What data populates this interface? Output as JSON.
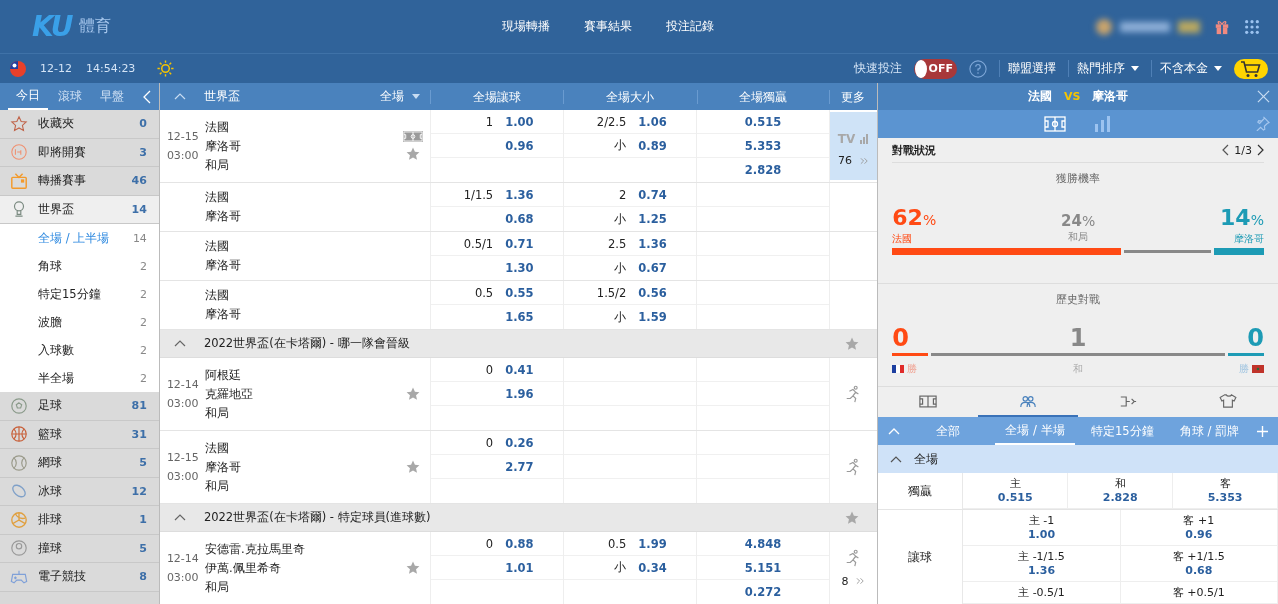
{
  "header": {
    "logo": {
      "mark": "KU",
      "text": "體育"
    },
    "nav": [
      "現場轉播",
      "賽事結果",
      "投注記錄"
    ]
  },
  "subbar": {
    "date": "12-12",
    "time": "14:54:23",
    "quick_bet": {
      "label": "快速投注",
      "on": false,
      "state_text": "OFF"
    },
    "menus": [
      {
        "label": "聯盟選擇",
        "dropdown": false
      },
      {
        "label": "熱門排序",
        "dropdown": true
      },
      {
        "label": "不含本金",
        "dropdown": true
      }
    ]
  },
  "sidebar": {
    "tabs": [
      {
        "label": "今日",
        "selected": true
      },
      {
        "label": "滾球",
        "selected": false
      },
      {
        "label": "早盤",
        "selected": false
      }
    ],
    "items": [
      {
        "kind": "star",
        "label": "收藏夾",
        "count": "0",
        "expanded": false
      },
      {
        "kind": "clock",
        "label": "即將開賽",
        "count": "3",
        "expanded": false
      },
      {
        "kind": "tv",
        "label": "轉播賽事",
        "count": "46",
        "expanded": false
      },
      {
        "kind": "trophy",
        "label": "世界盃",
        "count": "14",
        "expanded": true,
        "children": [
          {
            "label": "全場 / 上半場",
            "count": "14",
            "selected": true
          },
          {
            "label": "角球",
            "count": "2",
            "selected": false
          },
          {
            "label": "特定15分鐘",
            "count": "2",
            "selected": false
          },
          {
            "label": "波膽",
            "count": "2",
            "selected": false
          },
          {
            "label": "入球數",
            "count": "2",
            "selected": false
          },
          {
            "label": "半全場",
            "count": "2",
            "selected": false
          }
        ]
      },
      {
        "kind": "soccer",
        "label": "足球",
        "count": "81",
        "expanded": false
      },
      {
        "kind": "basketball",
        "label": "籃球",
        "count": "31",
        "expanded": false
      },
      {
        "kind": "tennis",
        "label": "網球",
        "count": "5",
        "expanded": false
      },
      {
        "kind": "hockey",
        "label": "冰球",
        "count": "12",
        "expanded": false
      },
      {
        "kind": "volleyball",
        "label": "排球",
        "count": "1",
        "expanded": false
      },
      {
        "kind": "billiards",
        "label": "撞球",
        "count": "5",
        "expanded": false
      },
      {
        "kind": "gamepad",
        "label": "電子競技",
        "count": "8",
        "expanded": false
      }
    ]
  },
  "table": {
    "league": "世界盃",
    "period": "全場",
    "columns": [
      "全場讓球",
      "全場大小",
      "全場獨贏",
      "更多"
    ],
    "groups": [
      {
        "matches": [
          {
            "date": "12-15",
            "time": "03:00",
            "teams": [
              "法國",
              "摩洛哥",
              "和局"
            ],
            "field_icon": true,
            "favorite": false,
            "lines": [
              {
                "hdp": "1",
                "hdp_odds": "1.00",
                "ou": "2/2.5",
                "ou_odds": "1.06",
                "win": "0.515"
              },
              {
                "hdp_odds": "0.96",
                "ou": "小",
                "ou_odds": "0.89",
                "win": "5.353"
              },
              {
                "win": "2.828"
              }
            ],
            "more": {
              "kind": "tv",
              "label": "TV",
              "count": "76",
              "selected": true
            }
          },
          {
            "teams": [
              "法國",
              "摩洛哥"
            ],
            "lines": [
              {
                "hdp": "1/1.5",
                "hdp_odds": "1.36",
                "ou": "2",
                "ou_odds": "0.74"
              },
              {
                "hdp_odds": "0.68",
                "ou": "小",
                "ou_odds": "1.25"
              }
            ]
          },
          {
            "teams": [
              "法國",
              "摩洛哥"
            ],
            "lines": [
              {
                "hdp": "0.5/1",
                "hdp_odds": "0.71",
                "ou": "2.5",
                "ou_odds": "1.36"
              },
              {
                "hdp_odds": "1.30",
                "ou": "小",
                "ou_odds": "0.67"
              }
            ]
          },
          {
            "teams": [
              "法國",
              "摩洛哥"
            ],
            "lines": [
              {
                "hdp": "0.5",
                "hdp_odds": "0.55",
                "ou": "1.5/2",
                "ou_odds": "0.56"
              },
              {
                "hdp_odds": "1.65",
                "ou": "小",
                "ou_odds": "1.59"
              }
            ]
          }
        ]
      },
      {
        "title": "2022世界盃(在卡塔爾) - 哪一隊會晉級",
        "matches": [
          {
            "date": "12-14",
            "time": "03:00",
            "teams": [
              "阿根廷",
              "克羅地亞",
              "和局"
            ],
            "favorite": false,
            "lines": [
              {
                "hdp": "0",
                "hdp_odds": "0.41"
              },
              {
                "hdp_odds": "1.96"
              }
            ],
            "more": {
              "kind": "live",
              "selected": false
            }
          },
          {
            "date": "12-15",
            "time": "03:00",
            "teams": [
              "法國",
              "摩洛哥",
              "和局"
            ],
            "favorite": false,
            "lines": [
              {
                "hdp": "0",
                "hdp_odds": "0.26"
              },
              {
                "hdp_odds": "2.77"
              }
            ],
            "more": {
              "kind": "live",
              "selected": false
            }
          }
        ]
      },
      {
        "title": "2022世界盃(在卡塔爾) - 特定球員(進球數)",
        "matches": [
          {
            "date": "12-14",
            "time": "03:00",
            "teams": [
              "安德雷.克拉馬里奇",
              "伊萬.佩里希奇",
              "和局"
            ],
            "favorite": false,
            "lines": [
              {
                "hdp": "0",
                "hdp_odds": "0.88",
                "ou": "0.5",
                "ou_odds": "1.99",
                "win": "4.848"
              },
              {
                "hdp_odds": "1.01",
                "ou": "小",
                "ou_odds": "0.34",
                "win": "5.151"
              },
              {
                "win": "0.272"
              }
            ],
            "more": {
              "kind": "live",
              "count": "8",
              "selected": false
            }
          }
        ]
      }
    ]
  },
  "detail": {
    "home": "法國",
    "vs": "VS",
    "away": "摩洛哥",
    "view_tabs": [
      {
        "kind": "field",
        "selected": true
      },
      {
        "kind": "stats",
        "selected": false
      }
    ],
    "stats": {
      "title": "對戰狀況",
      "page": "1/3",
      "win_prob": {
        "title": "獲勝機率",
        "items": [
          {
            "kind": "home",
            "value": "62",
            "unit": "%",
            "label": "法國"
          },
          {
            "kind": "draw",
            "value": "24",
            "unit": "%",
            "label": "和局"
          },
          {
            "kind": "away",
            "value": "14",
            "unit": "%",
            "label": "摩洛哥"
          }
        ]
      },
      "history": {
        "title": "歷史對戰",
        "items": [
          {
            "kind": "home",
            "value": "0",
            "label": "勝"
          },
          {
            "kind": "draw",
            "value": "1",
            "label": "和"
          },
          {
            "kind": "away",
            "value": "0",
            "label": "勝"
          }
        ]
      }
    },
    "icon_tabs": [
      {
        "kind": "field",
        "selected": false
      },
      {
        "kind": "players",
        "selected": true
      },
      {
        "kind": "substitution",
        "selected": false
      },
      {
        "kind": "shirt",
        "selected": false
      }
    ],
    "market_tabs": [
      {
        "label": "全部",
        "selected": false
      },
      {
        "label": "全場 / 半場",
        "selected": true
      },
      {
        "label": "特定15分鐘",
        "selected": false
      },
      {
        "label": "角球 / 罰牌",
        "selected": false
      }
    ],
    "section": "全場",
    "markets": [
      {
        "label": "獨贏",
        "rows": [
          [
            {
              "label": "主",
              "odds": "0.515"
            },
            {
              "label": "和",
              "odds": "2.828"
            },
            {
              "label": "客",
              "odds": "5.353"
            }
          ]
        ]
      },
      {
        "label": "讓球",
        "rows": [
          [
            {
              "label": "主 -1",
              "odds": "1.00"
            },
            {
              "label": "客 +1",
              "odds": "0.96"
            }
          ],
          [
            {
              "label": "主 -1/1.5",
              "odds": "1.36"
            },
            {
              "label": "客 +1/1.5",
              "odds": "0.68"
            }
          ],
          [
            {
              "label": "主 -0.5/1"
            },
            {
              "label": "客 +0.5/1"
            }
          ]
        ]
      }
    ]
  }
}
